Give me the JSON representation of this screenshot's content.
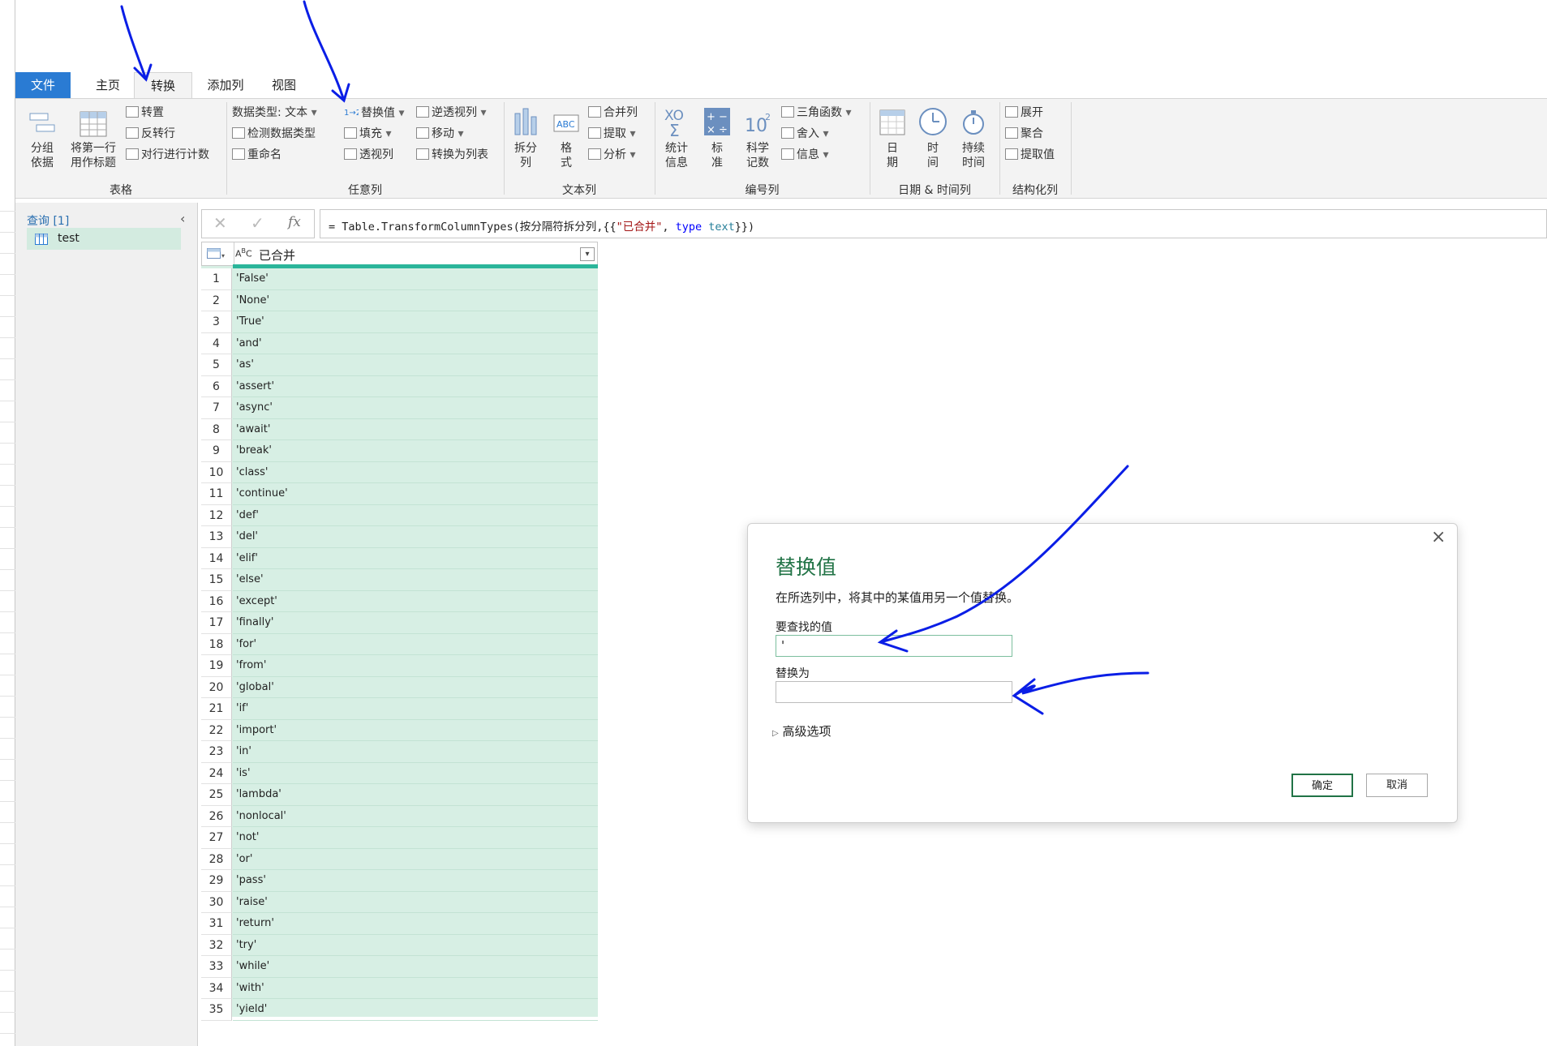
{
  "tabs": [
    "文件",
    "主页",
    "转换",
    "添加列",
    "视图"
  ],
  "ribbon": {
    "table_group": {
      "label": "表格",
      "group_by": "分组\n依据",
      "use_first_row": "将第一行\n用作标题",
      "transpose": "转置",
      "reverse_rows": "反转行",
      "count_rows": "对行进行计数"
    },
    "any_column_group": {
      "label": "任意列",
      "data_type": "数据类型: 文本",
      "detect_type": "检测数据类型",
      "rename": "重命名",
      "replace_values": "替换值",
      "fill": "填充",
      "pivot": "透视列",
      "unpivot": "逆透视列",
      "move": "移动",
      "convert_list": "转换为列表"
    },
    "text_group": {
      "label": "文本列",
      "split": "拆分\n列",
      "format": "格\n式",
      "merge": "合并列",
      "extract": "提取",
      "parse": "分析"
    },
    "number_group": {
      "label": "编号列",
      "statistics": "统计\n信息",
      "standard": "标\n准",
      "scientific": "科学\n记数",
      "trig": "三角函数",
      "rounding": "舍入",
      "info": "信息"
    },
    "date_group": {
      "label": "日期 & 时间列",
      "date": "日\n期",
      "time": "时\n间",
      "duration": "持续\n时间"
    },
    "struct_group": {
      "label": "结构化列",
      "expand": "展开",
      "aggregate": "聚合",
      "extract_values": "提取值"
    }
  },
  "left_panel": {
    "title": "查询 [1]",
    "query_name": "test"
  },
  "formula_bar": {
    "prefix": "= Table.TransformColumnTypes(按分隔符拆分列,{{",
    "string": "\"已合并\"",
    "mid": ", ",
    "keyword": "type",
    "type_name": "text",
    "suffix": "}})"
  },
  "grid": {
    "column_header": "已合并",
    "rows": [
      "'False'",
      "'None'",
      "'True'",
      "'and'",
      "'as'",
      "'assert'",
      "'async'",
      "'await'",
      "'break'",
      "'class'",
      "'continue'",
      "'def'",
      "'del'",
      "'elif'",
      "'else'",
      "'except'",
      "'finally'",
      "'for'",
      "'from'",
      "'global'",
      "'if'",
      "'import'",
      "'in'",
      "'is'",
      "'lambda'",
      "'nonlocal'",
      "'not'",
      "'or'",
      "'pass'",
      "'raise'",
      "'return'",
      "'try'",
      "'while'",
      "'with'",
      "'yield'"
    ]
  },
  "dialog": {
    "title": "替换值",
    "description": "在所选列中，将其中的某值用另一个值替换。",
    "find_label": "要查找的值",
    "find_value": "'",
    "replace_label": "替换为",
    "replace_value": "",
    "advanced": "高级选项",
    "ok": "确定",
    "cancel": "取消"
  },
  "colors": {
    "accent_green": "#217346",
    "file_tab_blue": "#2a7bd3",
    "annotation_blue": "#0a1ee6"
  }
}
